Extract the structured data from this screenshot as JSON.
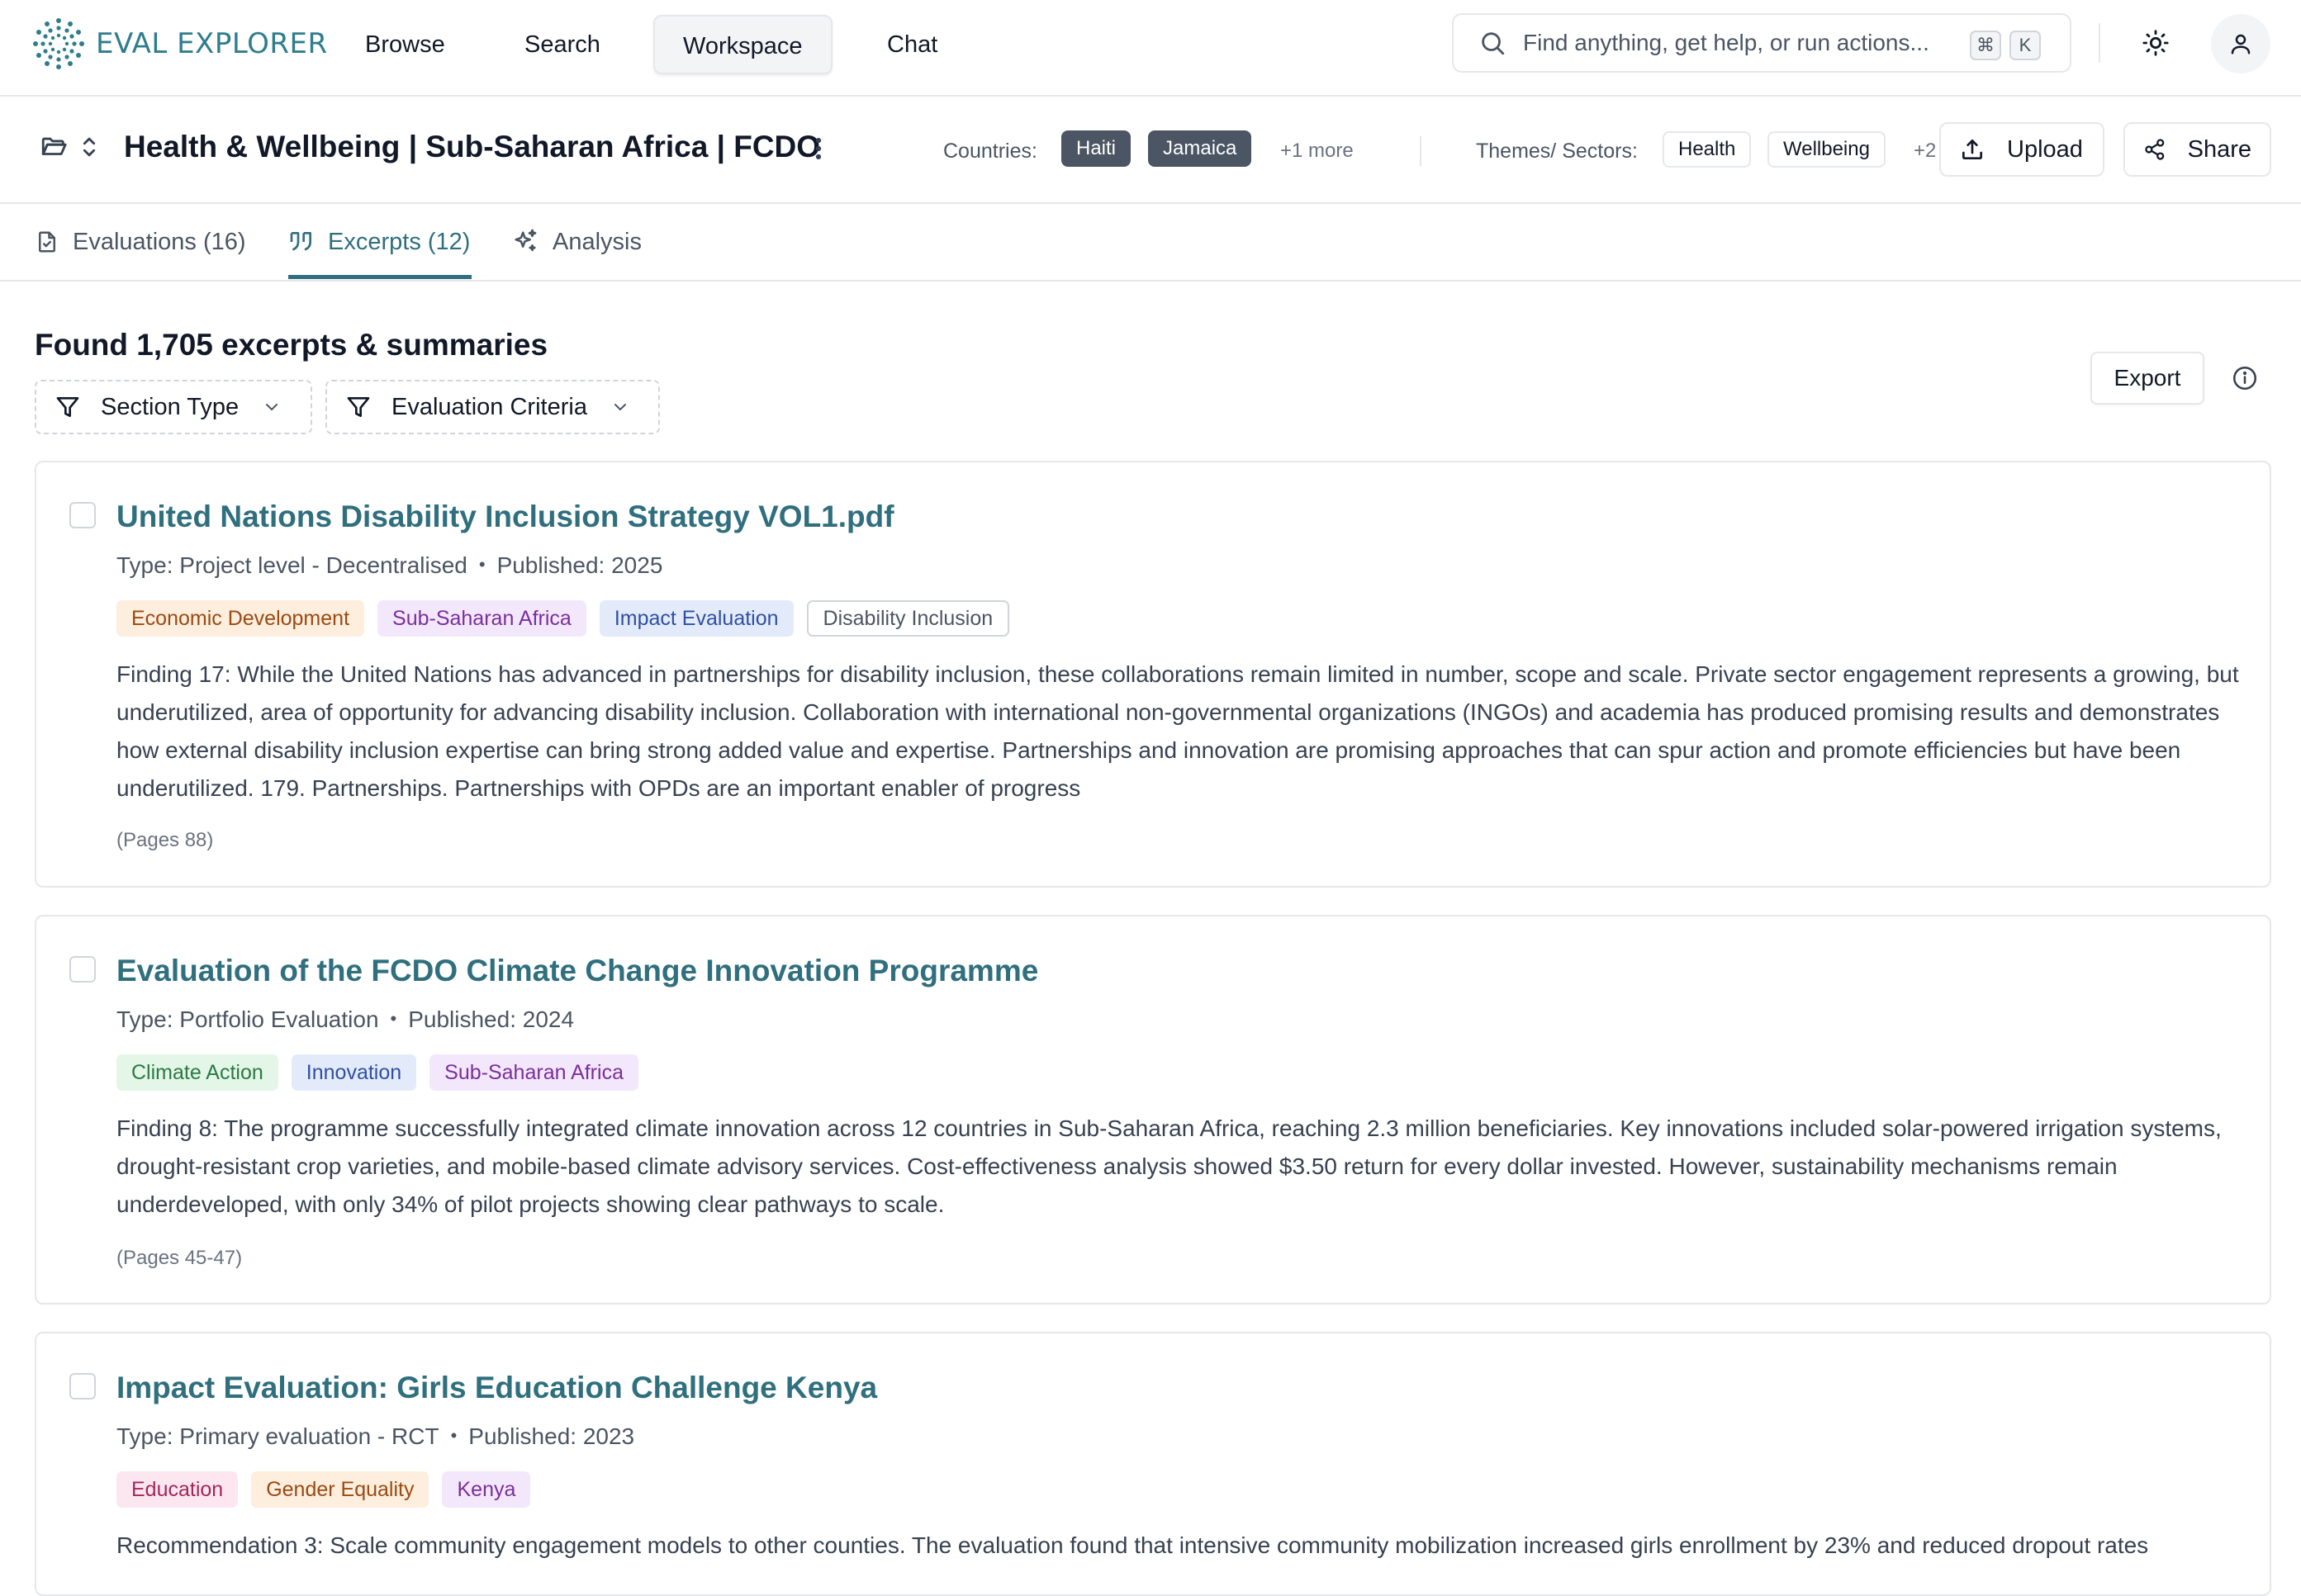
{
  "app": {
    "name": "EVAL EXPLORER"
  },
  "nav": {
    "items": [
      {
        "label": "Browse"
      },
      {
        "label": "Search"
      },
      {
        "label": "Workspace",
        "active": true
      },
      {
        "label": "Chat"
      }
    ]
  },
  "search": {
    "placeholder": "Find anything, get help, or run actions...",
    "shortcut_mod": "⌘",
    "shortcut_key": "K"
  },
  "workspace": {
    "title": "Health & Wellbeing | Sub-Saharan Africa | FCDO",
    "countries_label": "Countries:",
    "countries": [
      "Haiti",
      "Jamaica"
    ],
    "countries_more": "+1 more",
    "themes_label": "Themes/ Sectors:",
    "themes": [
      "Health",
      "Wellbeing"
    ],
    "themes_more": "+2",
    "upload_label": "Upload",
    "share_label": "Share"
  },
  "tabs": [
    {
      "label": "Evaluations (16)",
      "icon": "file-check-icon"
    },
    {
      "label": "Excerpts (12)",
      "icon": "quote-icon",
      "active": true
    },
    {
      "label": "Analysis",
      "icon": "sparkles-icon"
    }
  ],
  "results": {
    "heading": "Found 1,705 excerpts & summaries",
    "filters": [
      {
        "label": "Section Type"
      },
      {
        "label": "Evaluation Criteria"
      }
    ],
    "export_label": "Export"
  },
  "cards": [
    {
      "title": "United Nations Disability Inclusion Strategy VOL1.pdf",
      "type": "Type: Project level - Decentralised",
      "published": "Published: 2025",
      "tags": [
        {
          "label": "Economic Development",
          "color": "#fdeedd"
        },
        {
          "label": "Sub-Saharan Africa",
          "color": "#f3e8fb"
        },
        {
          "label": "Impact Evaluation",
          "color": "#e3ebfa"
        },
        {
          "label": "Disability Inclusion",
          "color": "#ffffff"
        }
      ],
      "text": "Finding 17: While the United Nations has advanced in partnerships for disability inclusion, these collaborations remain limited in number, scope and scale. Private sector engagement represents a growing, but underutilized, area of opportunity for advancing disability inclusion. Collaboration with international non-governmental organizations (INGOs) and academia has produced promising results and demonstrates how external disability inclusion expertise can bring strong added value and expertise. Partnerships and innovation are promising approaches that can spur action and promote efficiencies but have been underutilized. 179. Partnerships. Partnerships with OPDs are an important enabler of progress",
      "pages": "(Pages 88)"
    },
    {
      "title": "Evaluation of the FCDO Climate Change Innovation Programme",
      "type": "Type: Portfolio Evaluation",
      "published": "Published: 2024",
      "tags": [
        {
          "label": "Climate Action",
          "color": "#e3f6e8"
        },
        {
          "label": "Innovation",
          "color": "#e3ebfa"
        },
        {
          "label": "Sub-Saharan Africa",
          "color": "#f3e8fb"
        }
      ],
      "text": "Finding 8: The programme successfully integrated climate innovation across 12 countries in Sub-Saharan Africa, reaching 2.3 million beneficiaries. Key innovations included solar-powered irrigation systems, drought-resistant crop varieties, and mobile-based climate advisory services. Cost-effectiveness analysis showed $3.50 return for every dollar invested. However, sustainability mechanisms remain underdeveloped, with only 34% of pilot projects showing clear pathways to scale.",
      "pages": "(Pages 45-47)"
    },
    {
      "title": "Impact Evaluation: Girls Education Challenge Kenya",
      "type": "Type: Primary evaluation - RCT",
      "published": "Published: 2023",
      "tags": [
        {
          "label": "Education",
          "color": "#fce7f1"
        },
        {
          "label": "Gender Equality",
          "color": "#fdeedd"
        },
        {
          "label": "Kenya",
          "color": "#f3e8fb"
        }
      ],
      "text": "Recommendation 3: Scale community engagement models to other counties. The evaluation found that intensive community mobilization increased girls enrollment by 23% and reduced dropout rates"
    }
  ]
}
